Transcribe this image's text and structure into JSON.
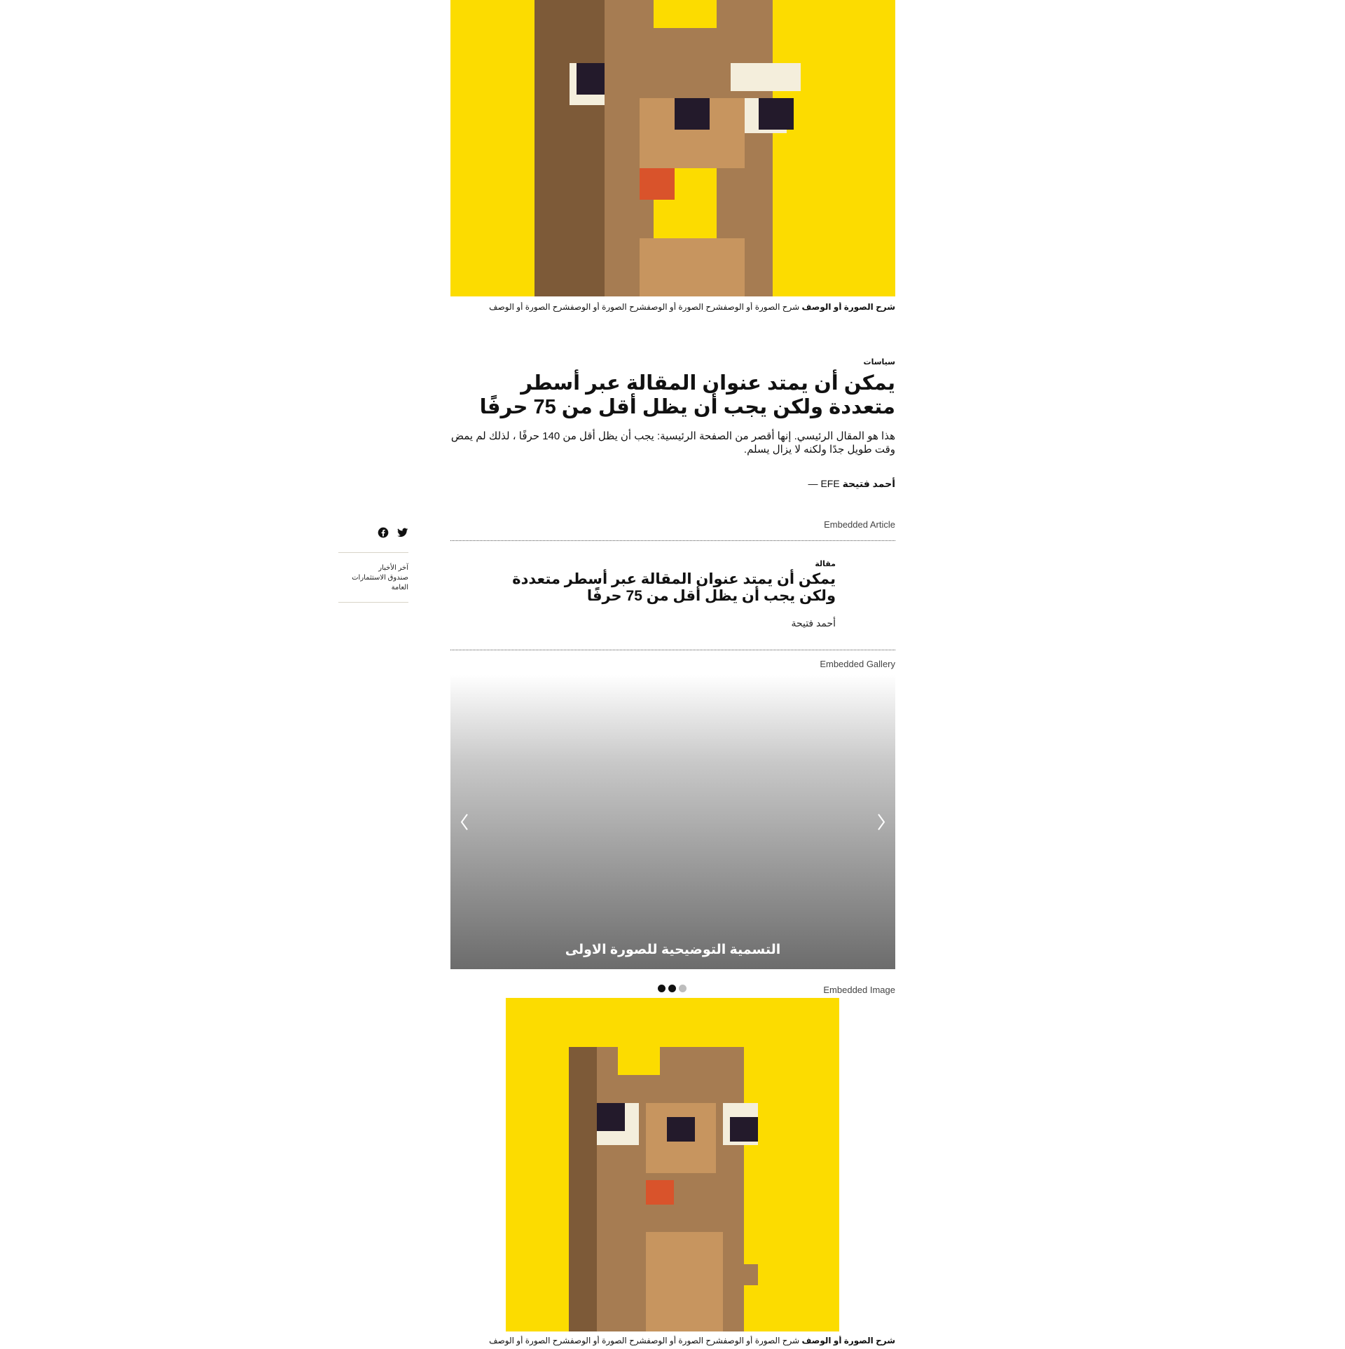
{
  "hero": {
    "caption_bold": "شرح الصورة أو الوصف",
    "caption_text": "شرح الصورة أو الوصفشرح الصورة أو الوصفشرح الصورة أو الوصفشرح الصورة أو الوصف"
  },
  "article": {
    "kicker": "سياسات",
    "headline_line1": "يمكن أن يمتد عنوان المقالة عبر أسطر",
    "headline_line2": "متعددة ولكن يجب أن يظل أقل من 75 حرفًا",
    "dek": "هذا هو المقال الرئيسي. إنها أقصر من الصفحة الرئيسية: يجب أن يظل أقل من 140 حرفًا ، لذلك لم يمض وقت طويل جدًا ولكنه لا يزال يسلم.",
    "author": "أحمد فتيحة",
    "source": "EFE —"
  },
  "embedded_article": {
    "label": "Embedded Article",
    "kicker": "مقالة",
    "title_line1": "يمكن أن يمتد عنوان المقالة عبر أسطر متعددة",
    "title_line2": "ولكن يجب أن يظل أقل من 75 حرفًا",
    "author": "أحمد فتيحة"
  },
  "embedded_gallery": {
    "label": "Embedded Gallery",
    "caption": "التسمية التوضيحية للصورة الاولى",
    "active_index": 1,
    "slide_count": 3
  },
  "embedded_image": {
    "label": "Embedded Image",
    "caption_bold": "شرح الصورة أو الوصف",
    "caption_text": "شرح الصورة أو الوصفشرح الصورة أو الوصفشرح الصورة أو الوصفشرح الصورة أو الوصف"
  },
  "sidebar": {
    "share_icons": [
      "twitter-icon",
      "facebook-icon"
    ],
    "links": [
      "آخر الأخبار",
      "صندوق الاستثمارات العامة"
    ]
  },
  "colors": {
    "mascot_background": "#FCDC00",
    "mascot_dark_brown": "#7D5A38",
    "mascot_mid_brown": "#A67C52",
    "mascot_light_brown": "#C7955F",
    "mascot_eye_white": "#F4EEDC",
    "mascot_pupil": "#231A2B",
    "mascot_tongue": "#D9532B"
  }
}
